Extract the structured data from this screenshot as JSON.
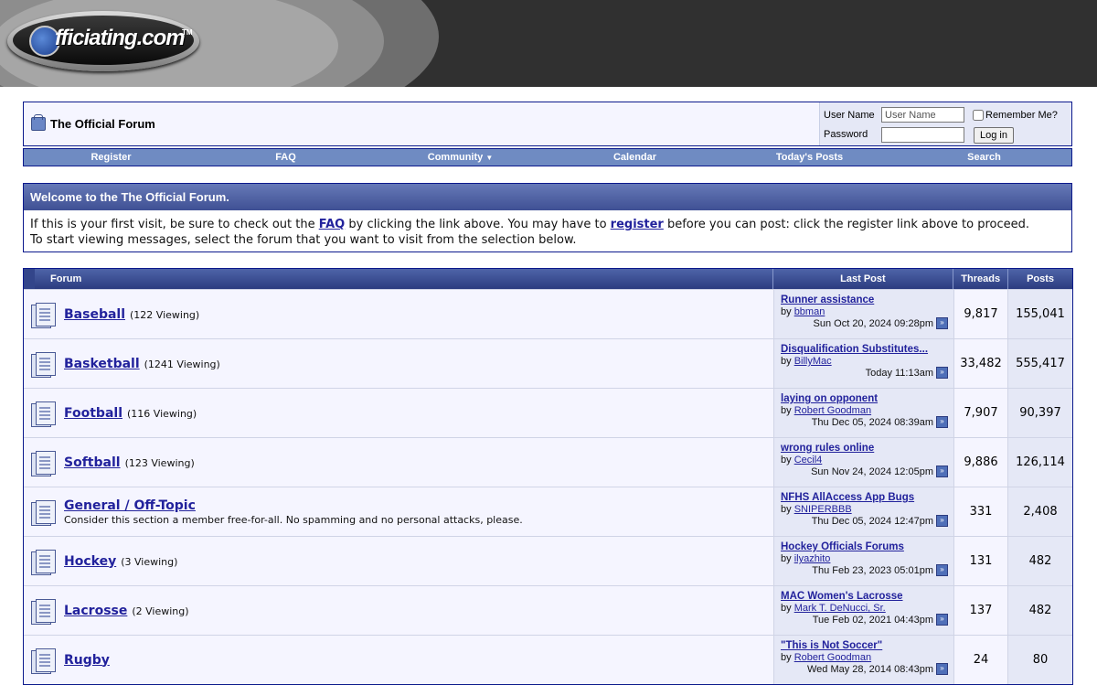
{
  "header": {
    "logo_text": "fficiating.com",
    "logo_tm": "TM"
  },
  "navbar": {
    "forum_title": "The Official Forum",
    "login": {
      "username_label": "User Name",
      "username_placeholder": "User Name",
      "password_label": "Password",
      "remember_label": "Remember Me?",
      "login_button": "Log in"
    },
    "links": [
      {
        "label": "Register"
      },
      {
        "label": "FAQ"
      },
      {
        "label": "Community",
        "has_dropdown": true
      },
      {
        "label": "Calendar"
      },
      {
        "label": "Today's Posts"
      },
      {
        "label": "Search"
      }
    ]
  },
  "welcome": {
    "title": "Welcome to the The Official Forum.",
    "text1": "If this is your first visit, be sure to check out the ",
    "faq_link": "FAQ",
    "text2": " by clicking the link above. You may have to ",
    "register_link": "register",
    "text3": " before you can post: click the register link above to proceed.",
    "text4": "To start viewing messages, select the forum that you want to visit from the selection below."
  },
  "forum_table": {
    "headers": {
      "forum": "Forum",
      "last_post": "Last Post",
      "threads": "Threads",
      "posts": "Posts"
    },
    "rows": [
      {
        "name": "Baseball",
        "viewing": "(122 Viewing)",
        "description": "",
        "last_title": "Runner assistance",
        "by": "by",
        "last_user": "bbman",
        "last_date": "Sun Oct 20, 2024 09:28pm",
        "threads": "9,817",
        "posts": "155,041"
      },
      {
        "name": "Basketball",
        "viewing": "(1241 Viewing)",
        "description": "",
        "last_title": "Disqualification Substitutes...",
        "by": "by",
        "last_user": "BillyMac",
        "last_date": "Today 11:13am",
        "threads": "33,482",
        "posts": "555,417"
      },
      {
        "name": "Football",
        "viewing": "(116 Viewing)",
        "description": "",
        "last_title": "laying on opponent",
        "by": "by",
        "last_user": "Robert Goodman",
        "last_date": "Thu Dec 05, 2024 08:39am",
        "threads": "7,907",
        "posts": "90,397"
      },
      {
        "name": "Softball",
        "viewing": "(123 Viewing)",
        "description": "",
        "last_title": "wrong rules online",
        "by": "by",
        "last_user": "Cecil4",
        "last_date": "Sun Nov 24, 2024 12:05pm",
        "threads": "9,886",
        "posts": "126,114"
      },
      {
        "name": "General / Off-Topic",
        "viewing": "",
        "description": "Consider this section a member free-for-all. No spamming and no personal attacks, please.",
        "last_title": "NFHS AllAccess App Bugs",
        "by": "by",
        "last_user": "SNIPERBBB",
        "last_date": "Thu Dec 05, 2024 12:47pm",
        "threads": "331",
        "posts": "2,408"
      },
      {
        "name": "Hockey",
        "viewing": "(3 Viewing)",
        "description": "",
        "last_title": "Hockey Officials Forums",
        "by": "by",
        "last_user": "ilyazhito",
        "last_date": "Thu Feb 23, 2023 05:01pm",
        "threads": "131",
        "posts": "482"
      },
      {
        "name": "Lacrosse",
        "viewing": "(2 Viewing)",
        "description": "",
        "last_title": "MAC Women's Lacrosse",
        "by": "by",
        "last_user": "Mark T. DeNucci, Sr.",
        "last_date": "Tue Feb 02, 2021 04:43pm",
        "threads": "137",
        "posts": "482"
      },
      {
        "name": "Rugby",
        "viewing": "",
        "description": "",
        "last_title": "\"This is Not Soccer\"",
        "by": "by",
        "last_user": "Robert Goodman",
        "last_date": "Wed May 28, 2014 08:43pm",
        "threads": "24",
        "posts": "80"
      }
    ]
  }
}
